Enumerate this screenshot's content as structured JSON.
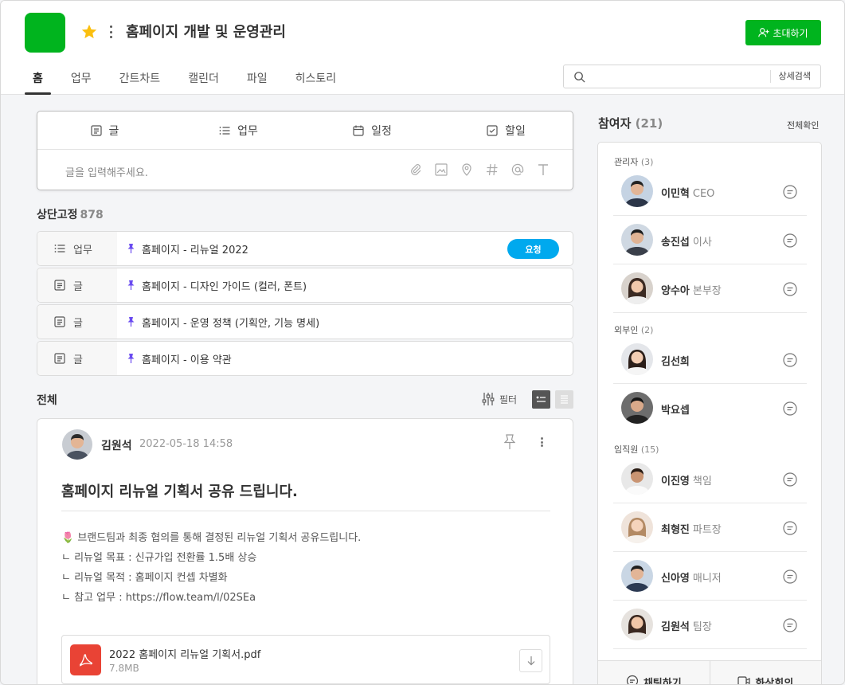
{
  "colors": {
    "brand": "#00b41e",
    "star": "#fbbf0f",
    "badge": "#00a9ee",
    "pdf": "#e94335",
    "pin": "#6a4bf0"
  },
  "project": {
    "title": "홈페이지 개발 및 운영관리",
    "invite_label": "초대하기"
  },
  "tabs": [
    "홈",
    "업무",
    "간트차트",
    "캘린더",
    "파일",
    "히스토리"
  ],
  "search": {
    "placeholder": "",
    "advanced_label": "상세검색"
  },
  "composer": {
    "tabs": [
      {
        "label": "글",
        "icon": "post-icon"
      },
      {
        "label": "업무",
        "icon": "task-list-icon"
      },
      {
        "label": "일정",
        "icon": "calendar-icon"
      },
      {
        "label": "할일",
        "icon": "checkbox-icon"
      }
    ],
    "placeholder": "글을 입력해주세요.",
    "tools": [
      "attach-icon",
      "image-icon",
      "location-icon",
      "hashtag-icon",
      "mention-icon",
      "text-format-icon"
    ]
  },
  "pinned": {
    "title": "상단고정",
    "count": "878",
    "items": [
      {
        "type": "업무",
        "icon": "task-list-icon",
        "text": "홈페이지 - 리뉴얼 2022",
        "badge": "요청"
      },
      {
        "type": "글",
        "icon": "post-icon",
        "text": "홈페이지 - 디자인 가이드 (컬러, 폰트)"
      },
      {
        "type": "글",
        "icon": "post-icon",
        "text": "홈페이지 - 운영 정책 (기획안, 기능 명세)"
      },
      {
        "type": "글",
        "icon": "post-icon",
        "text": "홈페이지 - 이용 약관"
      }
    ]
  },
  "feed": {
    "title": "전체",
    "filter_label": "필터",
    "post": {
      "author": "김원석",
      "date": "2022-05-18 14:58",
      "title": "홈페이지 리뉴얼 기획서 공유 드립니다.",
      "lines": [
        "🌷 브랜드팀과 최종 협의를 통해 결정된 리뉴얼 기획서 공유드립니다.",
        "ㄴ 리뉴얼 목표 : 신규가입 전환률 1.5배 상승",
        "ㄴ 리뉴얼 목적 : 홈페이지 컨셉 차별화",
        "ㄴ 참고 업무 : https://flow.team/l/02SEa"
      ],
      "attachment": {
        "name": "2022 홈페이지 리뉴얼 기획서.pdf",
        "size": "7.8MB"
      }
    }
  },
  "participants": {
    "title": "참여자",
    "count": "(21)",
    "view_all": "전체확인",
    "groups": [
      {
        "label": "관리자",
        "count": "(3)",
        "people": [
          {
            "name": "이민혁",
            "role": "CEO"
          },
          {
            "name": "송진섭",
            "role": "이사"
          },
          {
            "name": "양수아",
            "role": "본부장"
          }
        ]
      },
      {
        "label": "외부인",
        "count": "(2)",
        "people": [
          {
            "name": "김선희",
            "role": ""
          },
          {
            "name": "박요셉",
            "role": ""
          }
        ]
      },
      {
        "label": "임직원",
        "count": "(15)",
        "people": [
          {
            "name": "이진영",
            "role": "책임"
          },
          {
            "name": "최형진",
            "role": "파트장"
          },
          {
            "name": "신아영",
            "role": "매니저"
          },
          {
            "name": "김원석",
            "role": "팀장"
          }
        ]
      }
    ],
    "footer": {
      "chat_label": "채팅하기",
      "video_label": "화상회의"
    }
  }
}
